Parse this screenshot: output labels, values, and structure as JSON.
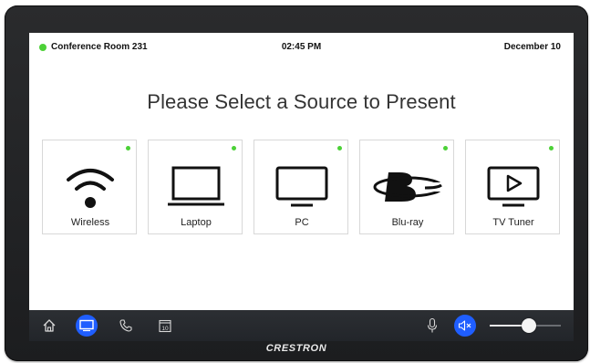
{
  "status_bar": {
    "room_name": "Conference Room 231",
    "time": "02:45 PM",
    "date": "December 10",
    "status_color": "#4cd137"
  },
  "heading": "Please Select a Source to Present",
  "sources": [
    {
      "label": "Wireless",
      "icon": "wifi-icon",
      "available": true
    },
    {
      "label": "Laptop",
      "icon": "laptop-icon",
      "available": true
    },
    {
      "label": "PC",
      "icon": "monitor-icon",
      "available": true
    },
    {
      "label": "Blu-ray",
      "icon": "bluray-icon",
      "available": true
    },
    {
      "label": "TV Tuner",
      "icon": "tv-play-icon",
      "available": true
    }
  ],
  "bottom_bar": {
    "nav": [
      {
        "icon": "home-icon",
        "active": false
      },
      {
        "icon": "display-icon",
        "active": true
      },
      {
        "icon": "phone-icon",
        "active": false
      },
      {
        "icon": "calendar-icon",
        "active": false,
        "text": "10"
      }
    ],
    "mic_icon": "microphone-icon",
    "mute_icon": "speaker-mute-icon",
    "volume_level": 0.55,
    "accent_color": "#1f5eff"
  },
  "brand": "CRESTRON"
}
